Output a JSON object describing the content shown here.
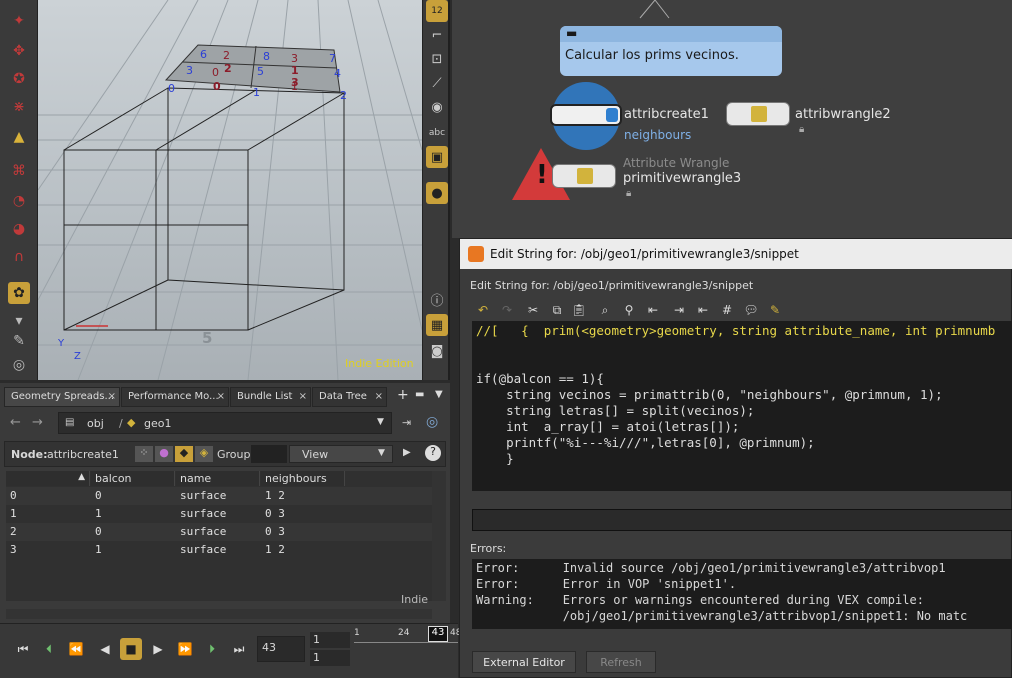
{
  "viewport": {
    "watermark": "Indie Edition",
    "grid_label": "5",
    "points": [
      {
        "label": "0",
        "color": "#2b3fd6"
      },
      {
        "label": "1",
        "color": "#2b3fd6"
      },
      {
        "label": "2",
        "color": "#2b3fd6"
      },
      {
        "label": "3",
        "color": "#2b3fd6"
      },
      {
        "label": "4",
        "color": "#2b3fd6"
      },
      {
        "label": "5",
        "color": "#2b3fd6"
      },
      {
        "label": "6",
        "color": "#2b3fd6"
      },
      {
        "label": "7",
        "color": "#2b3fd6"
      },
      {
        "label": "8",
        "color": "#2b3fd6"
      }
    ],
    "prims": [
      "0",
      "1",
      "2",
      "3"
    ],
    "prim_nums": [
      "0",
      "1",
      "2",
      "3"
    ],
    "axis_y": "Y",
    "axis_z": "Z"
  },
  "right_shelf": {
    "badge": "12",
    "abc": "abc"
  },
  "network": {
    "sticky_text": "Calcular los prims vecinos.",
    "nodes": [
      {
        "name": "attribcreate1",
        "sub": "neighbours"
      },
      {
        "name": "attribwrangle2",
        "sub": ""
      },
      {
        "name": "primitivewrangle3",
        "type_label": "Attribute Wrangle"
      }
    ]
  },
  "sheet": {
    "tabs": [
      "Geometry Spreads...",
      "Performance Mo...",
      "Bundle List",
      "Data Tree"
    ],
    "path": [
      "obj",
      "geo1"
    ],
    "node_label": "Node:",
    "node_value": "attribcreate1",
    "group_label": "Group:",
    "view_label": "View",
    "columns": [
      "balcon",
      "name",
      "neighbours"
    ],
    "rows": [
      {
        "idx": "0",
        "balcon": "0",
        "name": "surface",
        "neighbours": "1 2"
      },
      {
        "idx": "1",
        "balcon": "1",
        "name": "surface",
        "neighbours": "0 3"
      },
      {
        "idx": "2",
        "balcon": "0",
        "name": "surface",
        "neighbours": "0 3"
      },
      {
        "idx": "3",
        "balcon": "1",
        "name": "surface",
        "neighbours": "1 2"
      }
    ],
    "footer": "Indie"
  },
  "playbar": {
    "frame": "43",
    "start1": "1",
    "start2": "1",
    "ticks": [
      "1",
      "24",
      "48"
    ],
    "current_marker": "43"
  },
  "dialog": {
    "title": "Edit String for: /obj/geo1/primitivewrangle3/snippet",
    "subtitle": "Edit String for: /obj/geo1/primitivewrangle3/snippet",
    "code_lines": [
      "//[   {  prim(<geometry>geometry, string attribute_name, int primnumb",
      "",
      "",
      "if(@balcon == 1){",
      "    string vecinos = primattrib(0, \"neighbours\", @primnum, 1);",
      "    string letras[] = split(vecinos);",
      "    int  a_rray[] = atoi(letras[]);",
      "    printf(\"%i---%i///\",letras[0], @primnum);",
      "    }"
    ],
    "errors_label": "Errors:",
    "errors": [
      "Error:      Invalid source /obj/geo1/primitivewrangle3/attribvop1",
      "Error:      Error in VOP 'snippet1'.",
      "Warning:    Errors or warnings encountered during VEX compile:",
      "            /obj/geo1/primitivewrangle3/attribvop1/snippet1: No matc"
    ],
    "external_editor": "External Editor",
    "refresh": "Refresh"
  }
}
